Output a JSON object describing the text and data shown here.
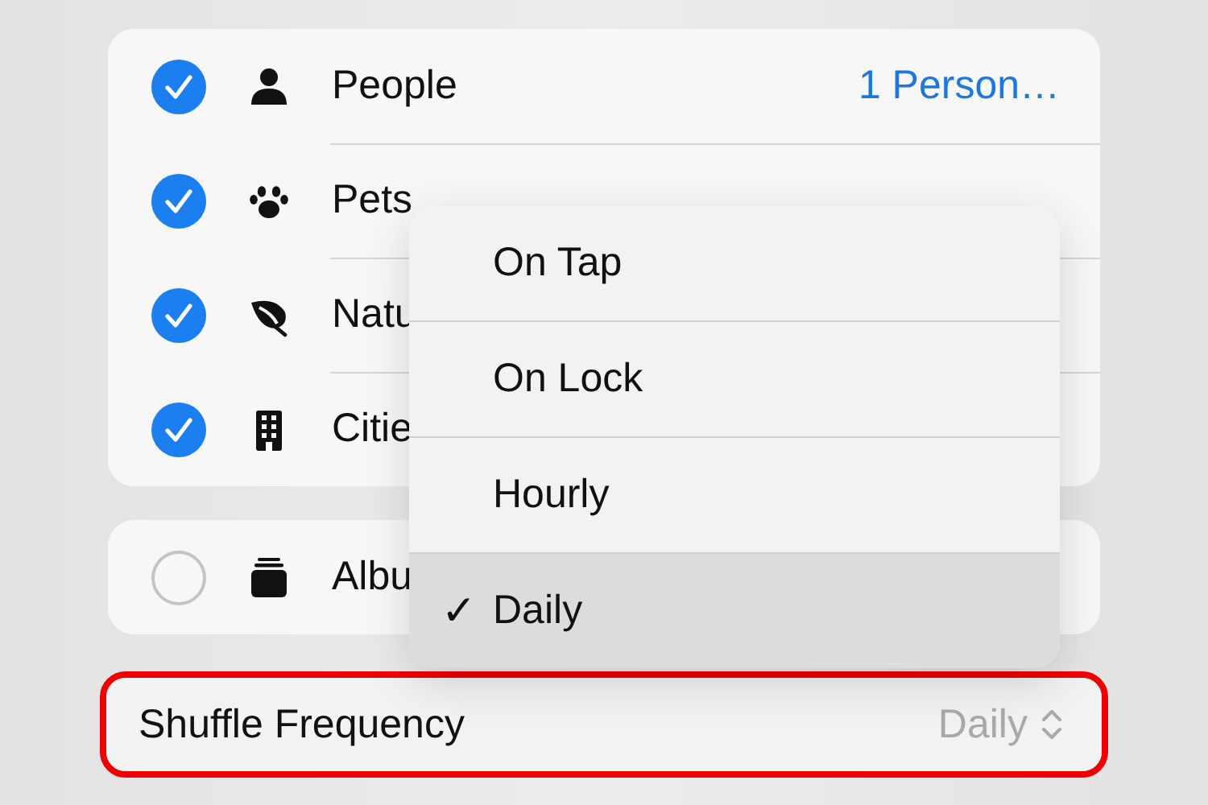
{
  "categories": [
    {
      "label": "People",
      "checked": true,
      "detail": "1 Person…"
    },
    {
      "label": "Pets",
      "checked": true
    },
    {
      "label": "Natu",
      "checked": true
    },
    {
      "label": "Citie",
      "checked": true
    }
  ],
  "albums": {
    "label": "Albu",
    "checked": false
  },
  "frequency_menu": {
    "items": [
      {
        "label": "On Tap",
        "selected": false
      },
      {
        "label": "On Lock",
        "selected": false
      },
      {
        "label": "Hourly",
        "selected": false
      },
      {
        "label": "Daily",
        "selected": true
      }
    ],
    "check": "✓"
  },
  "shuffle_frequency": {
    "label": "Shuffle Frequency",
    "value": "Daily",
    "highlighted": true
  }
}
